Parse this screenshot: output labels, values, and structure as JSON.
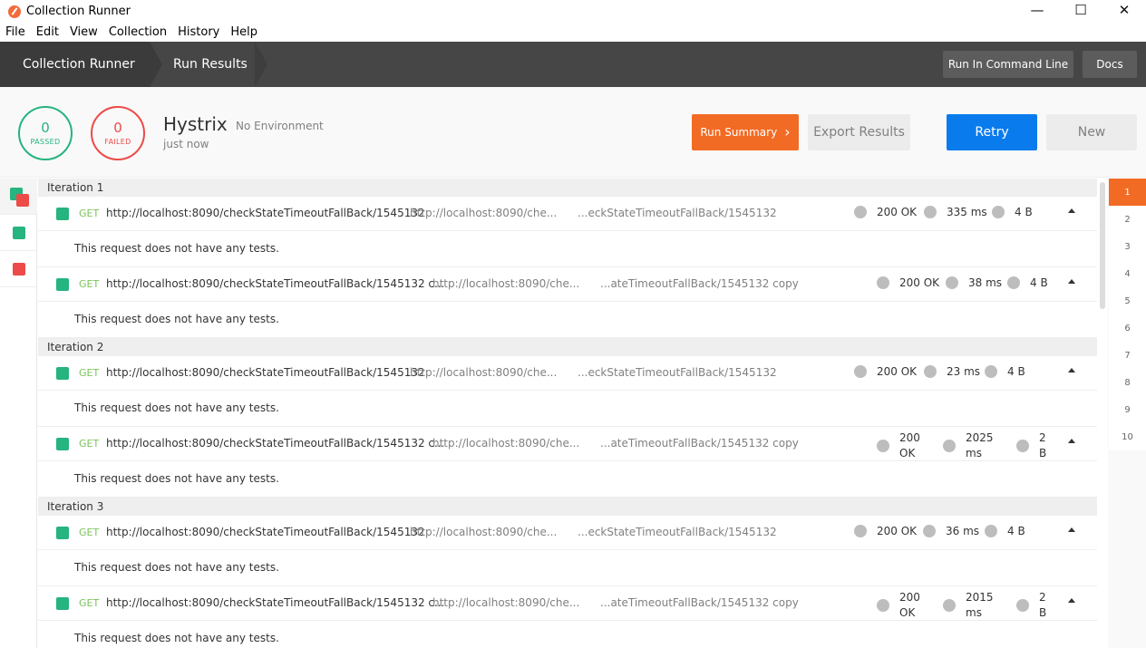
{
  "window": {
    "title": "Collection Runner",
    "minimize": "—",
    "maximize": "☐",
    "close": "✕"
  },
  "menu": [
    "File",
    "Edit",
    "View",
    "Collection",
    "History",
    "Help"
  ],
  "header": {
    "crumbs": [
      "Collection Runner",
      "Run Results"
    ],
    "run_cli": "Run In Command Line",
    "docs": "Docs"
  },
  "summary": {
    "passed_count": "0",
    "passed_label": "PASSED",
    "failed_count": "0",
    "failed_label": "FAILED",
    "collection": "Hystrix",
    "environment": "No Environment",
    "time": "just now",
    "run_summary": "Run Summary",
    "export": "Export Results",
    "retry": "Retry",
    "new": "New"
  },
  "colors": {
    "pass": "#26b47f",
    "fail": "#ed4b48",
    "accent": "#f26b25",
    "primary": "#097bed"
  },
  "no_tests_msg": "This request does not have any tests.",
  "iterations": [
    {
      "label": "Iteration 1",
      "requests": [
        {
          "method": "GET",
          "name": "http://localhost:8090/checkStateTimeoutFallBack/1545132",
          "url": "http://localhost:8090/che...",
          "path": "...eckStateTimeoutFallBack/1545132",
          "status": "200 OK",
          "time": "335 ms",
          "size": "4 B"
        },
        {
          "method": "GET",
          "name": "http://localhost:8090/checkStateTimeoutFallBack/1545132 c...",
          "url": "http://localhost:8090/che...",
          "path": "...ateTimeoutFallBack/1545132 copy",
          "status": "200 OK",
          "time": "38 ms",
          "size": "4 B"
        }
      ]
    },
    {
      "label": "Iteration 2",
      "requests": [
        {
          "method": "GET",
          "name": "http://localhost:8090/checkStateTimeoutFallBack/1545132",
          "url": "http://localhost:8090/che...",
          "path": "...eckStateTimeoutFallBack/1545132",
          "status": "200 OK",
          "time": "23 ms",
          "size": "4 B"
        },
        {
          "method": "GET",
          "name": "http://localhost:8090/checkStateTimeoutFallBack/1545132 c...",
          "url": "http://localhost:8090/che...",
          "path": "...ateTimeoutFallBack/1545132 copy",
          "status": "200 OK",
          "time": "2025 ms",
          "size": "2 B"
        }
      ]
    },
    {
      "label": "Iteration 3",
      "requests": [
        {
          "method": "GET",
          "name": "http://localhost:8090/checkStateTimeoutFallBack/1545132",
          "url": "http://localhost:8090/che...",
          "path": "...eckStateTimeoutFallBack/1545132",
          "status": "200 OK",
          "time": "36 ms",
          "size": "4 B"
        },
        {
          "method": "GET",
          "name": "http://localhost:8090/checkStateTimeoutFallBack/1545132 c...",
          "url": "http://localhost:8090/che...",
          "path": "...ateTimeoutFallBack/1545132 copy",
          "status": "200 OK",
          "time": "2015 ms",
          "size": "2 B"
        }
      ]
    }
  ],
  "iteration_nav": [
    "1",
    "2",
    "3",
    "4",
    "5",
    "6",
    "7",
    "8",
    "9",
    "10"
  ],
  "active_iteration": "1"
}
